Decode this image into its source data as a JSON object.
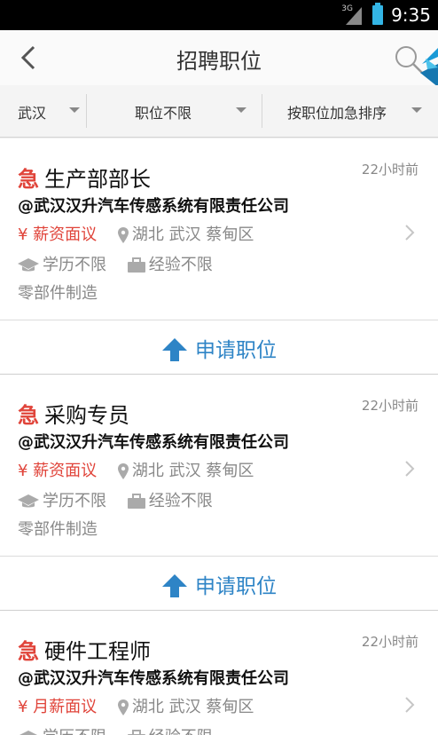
{
  "status_bar": {
    "time": "9:35",
    "network": "3G"
  },
  "header": {
    "title": "招聘职位",
    "back_icon": "chevron-left-icon",
    "search_icon": "search-icon"
  },
  "filters": [
    {
      "label": "武汉"
    },
    {
      "label": "职位不限"
    },
    {
      "label": "按职位加急排序"
    }
  ],
  "jobs": [
    {
      "badge": "急",
      "title": "生产部部长",
      "time": "22小时前",
      "company": "@武汉汉升汽车传感系统有限责任公司",
      "salary": "¥ 薪资面议",
      "location": "湖北 武汉 蔡甸区",
      "education": "学历不限",
      "experience": "经验不限",
      "industry": "零部件制造",
      "apply_label": "申请职位"
    },
    {
      "badge": "急",
      "title": "采购专员",
      "time": "22小时前",
      "company": "@武汉汉升汽车传感系统有限责任公司",
      "salary": "¥ 薪资面议",
      "location": "湖北 武汉 蔡甸区",
      "education": "学历不限",
      "experience": "经验不限",
      "industry": "零部件制造",
      "apply_label": "申请职位"
    },
    {
      "badge": "急",
      "title": "硬件工程师",
      "time": "22小时前",
      "company": "@武汉汉升汽车传感系统有限责任公司",
      "salary": "¥ 月薪面议",
      "location": "湖北 武汉 蔡甸区",
      "education": "学历不限",
      "experience": "经验不限"
    }
  ],
  "colors": {
    "accent_blue": "#2e84c6",
    "urgent_red": "#e0443a",
    "status_bar": "#000000"
  }
}
